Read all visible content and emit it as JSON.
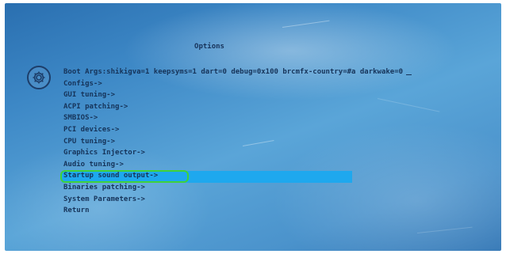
{
  "screen": {
    "title": "Options"
  },
  "boot_args": {
    "text": "Boot Args:shikigva=1 keepsyms=1 dart=0 debug=0x100 brcmfx-country=#a darkwake=0"
  },
  "menu": {
    "items": [
      {
        "label": "Configs->"
      },
      {
        "label": "GUI tuning->"
      },
      {
        "label": "ACPI patching->"
      },
      {
        "label": "SMBIOS->"
      },
      {
        "label": "PCI devices->"
      },
      {
        "label": "CPU tuning->"
      },
      {
        "label": "Graphics Injector->"
      },
      {
        "label": "Audio tuning->"
      },
      {
        "label": "Startup sound output->"
      },
      {
        "label": "Binaries patching->"
      },
      {
        "label": "System Parameters->"
      },
      {
        "label": "Return"
      }
    ],
    "selected_index": 8
  },
  "icons": {
    "options": "gear-icon"
  },
  "colors": {
    "background": "#4b93cc",
    "text": "#16345a",
    "selection_bar": "#1ea8ee",
    "selection_outline": "#3fd23a"
  }
}
